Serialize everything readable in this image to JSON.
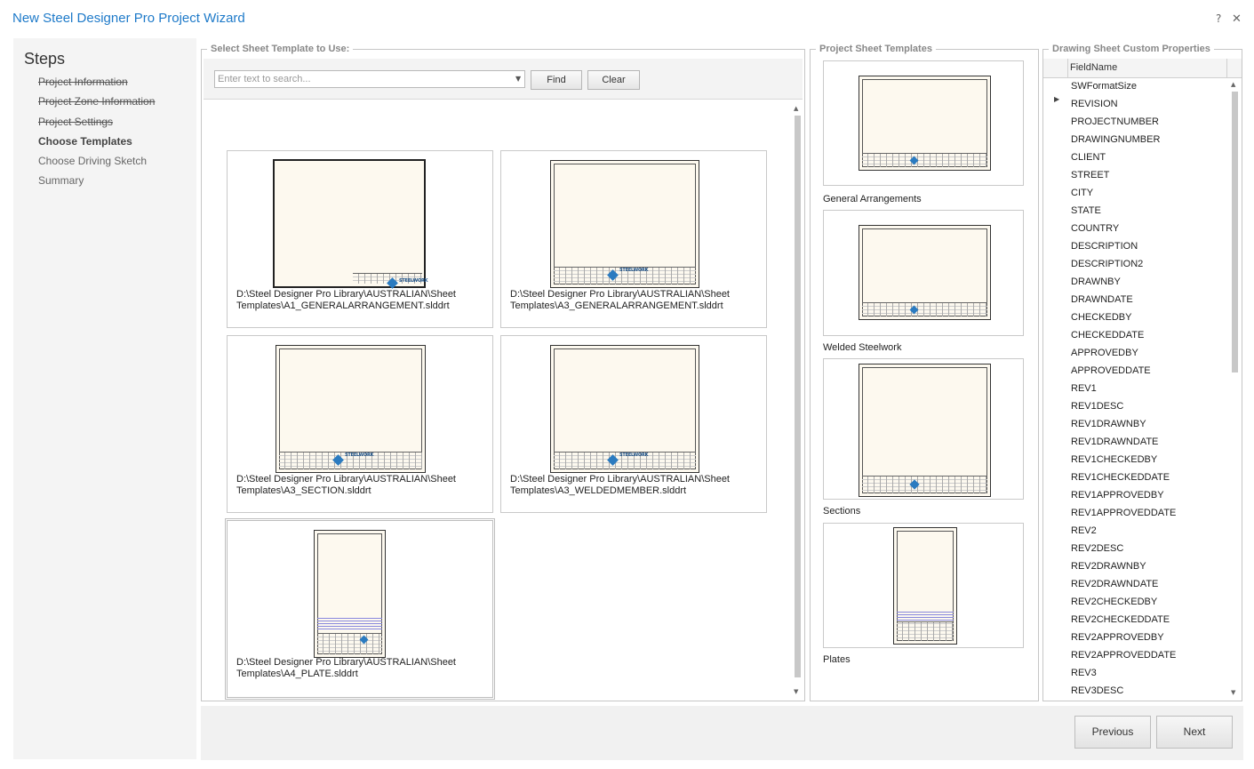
{
  "window": {
    "title": "New Steel Designer Pro Project Wizard",
    "help": "?",
    "close": "✕"
  },
  "steps": {
    "heading": "Steps",
    "items": [
      {
        "label": "Project Information",
        "state": "done"
      },
      {
        "label": "Project Zone Information",
        "state": "done"
      },
      {
        "label": "Project Settings",
        "state": "done"
      },
      {
        "label": "Choose Templates",
        "state": "active"
      },
      {
        "label": "Choose Driving Sketch",
        "state": "future"
      },
      {
        "label": "Summary",
        "state": "future"
      }
    ]
  },
  "select_panel": {
    "title": "Select Sheet Template to Use:",
    "search_placeholder": "Enter text to search...",
    "find_label": "Find",
    "clear_label": "Clear",
    "templates": [
      {
        "caption": "D:\\Steel Designer Pro Library\\AUSTRALIAN\\Sheet Templates\\A1_GENERALARRANGEMENT.slddrt"
      },
      {
        "caption": "D:\\Steel Designer Pro Library\\AUSTRALIAN\\Sheet Templates\\A3_GENERALARRANGEMENT.slddrt"
      },
      {
        "caption": "D:\\Steel Designer Pro Library\\AUSTRALIAN\\Sheet Templates\\A3_SECTION.slddrt"
      },
      {
        "caption": "D:\\Steel Designer Pro Library\\AUSTRALIAN\\Sheet Templates\\A3_WELDEDMEMBER.slddrt"
      },
      {
        "caption": "D:\\Steel Designer Pro Library\\AUSTRALIAN\\Sheet Templates\\A4_PLATE.slddrt"
      }
    ]
  },
  "project_panel": {
    "title": "Project Sheet Templates",
    "items": [
      {
        "label": "General Arrangements"
      },
      {
        "label": "Welded Steelwork"
      },
      {
        "label": "Sections"
      },
      {
        "label": "Plates"
      }
    ]
  },
  "properties_panel": {
    "title": "Drawing Sheet Custom Properties",
    "column": "FieldName",
    "rows": [
      "SWFormatSize",
      "REVISION",
      "PROJECTNUMBER",
      "DRAWINGNUMBER",
      "CLIENT",
      "STREET",
      "CITY",
      "STATE",
      "COUNTRY",
      "DESCRIPTION",
      "DESCRIPTION2",
      "DRAWNBY",
      "DRAWNDATE",
      "CHECKEDBY",
      "CHECKEDDATE",
      "APPROVEDBY",
      "APPROVEDDATE",
      "REV1",
      "REV1DESC",
      "REV1DRAWNBY",
      "REV1DRAWNDATE",
      "REV1CHECKEDBY",
      "REV1CHECKEDDATE",
      "REV1APPROVEDBY",
      "REV1APPROVEDDATE",
      "REV2",
      "REV2DESC",
      "REV2DRAWNBY",
      "REV2DRAWNDATE",
      "REV2CHECKEDBY",
      "REV2CHECKEDDATE",
      "REV2APPROVEDBY",
      "REV2APPROVEDDATE",
      "REV3",
      "REV3DESC"
    ]
  },
  "footer": {
    "previous_label": "Previous",
    "next_label": "Next"
  },
  "thumbnail": {
    "logo_text": "STEELWORK"
  },
  "colors": {
    "title_blue": "#1e7ac9",
    "sheet_paper": "#fdf9ef",
    "logo_blue": "#2b7bc0"
  }
}
